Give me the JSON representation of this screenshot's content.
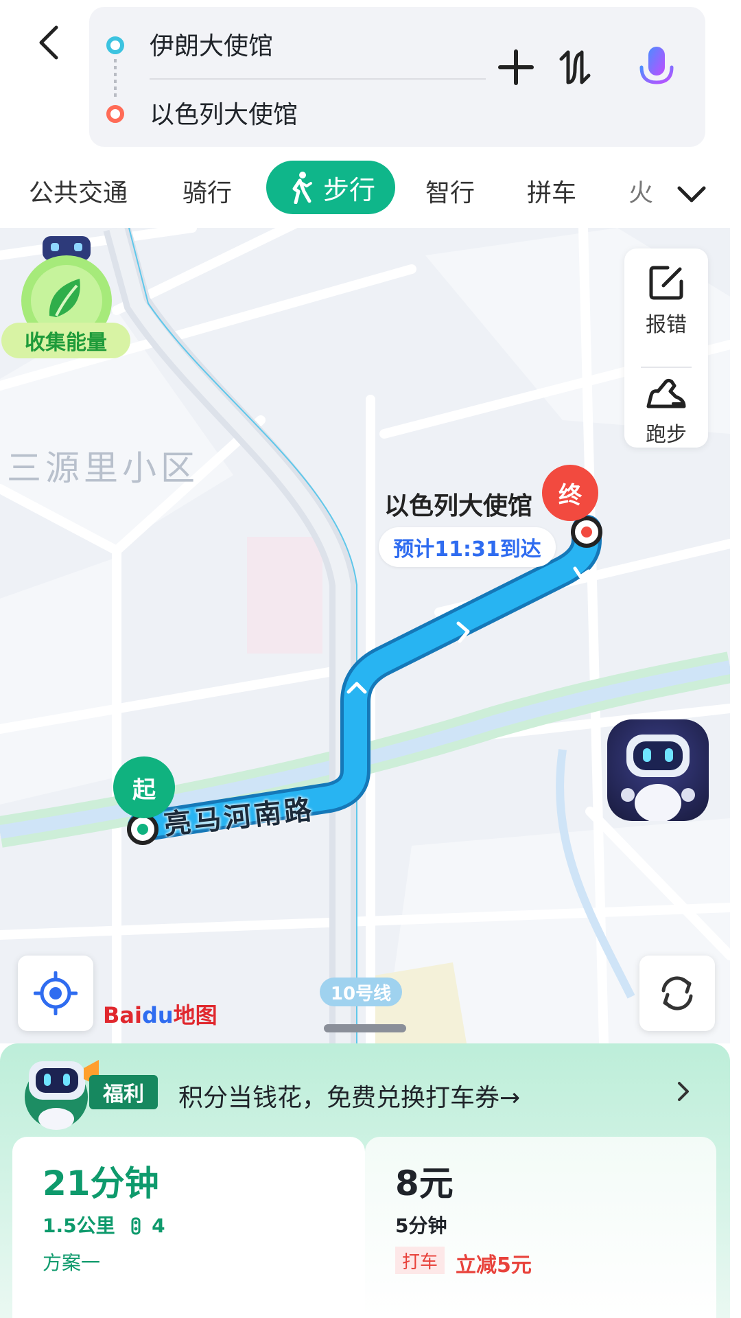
{
  "header": {
    "start": "伊朗大使馆",
    "end": "以色列大使馆"
  },
  "tabs": [
    {
      "label": "公共交通"
    },
    {
      "label": "骑行"
    },
    {
      "label": "步行",
      "active": true
    },
    {
      "label": "智行"
    },
    {
      "label": "拼车"
    },
    {
      "label": "火"
    }
  ],
  "map": {
    "energy_label": "收集能量",
    "district": "三源里小区",
    "side": {
      "report": "报错",
      "run": "跑步"
    },
    "destination": "以色列大使馆",
    "eta": "预计11:31到达",
    "end_marker": "终",
    "start_marker": "起",
    "road": "亮马河南路",
    "subway_line": "10号线",
    "logo_bai": "Bai",
    "logo_du": "du",
    "logo_map": "地图"
  },
  "promo": {
    "tag": "福利",
    "text": "积分当钱花，免费兑换打车券→"
  },
  "plans": [
    {
      "time": "21分钟",
      "distance": "1.5公里",
      "lights": "4",
      "name": "方案一"
    },
    {
      "price": "8元",
      "time": "5分钟",
      "tag": "打车",
      "discount": "立减5元"
    }
  ],
  "colors": {
    "accent": "#0fb68a",
    "route": "#26aef0",
    "end_pin": "#f24a3f",
    "start_pin": "#10b27f",
    "eta": "#2f6cf0"
  }
}
